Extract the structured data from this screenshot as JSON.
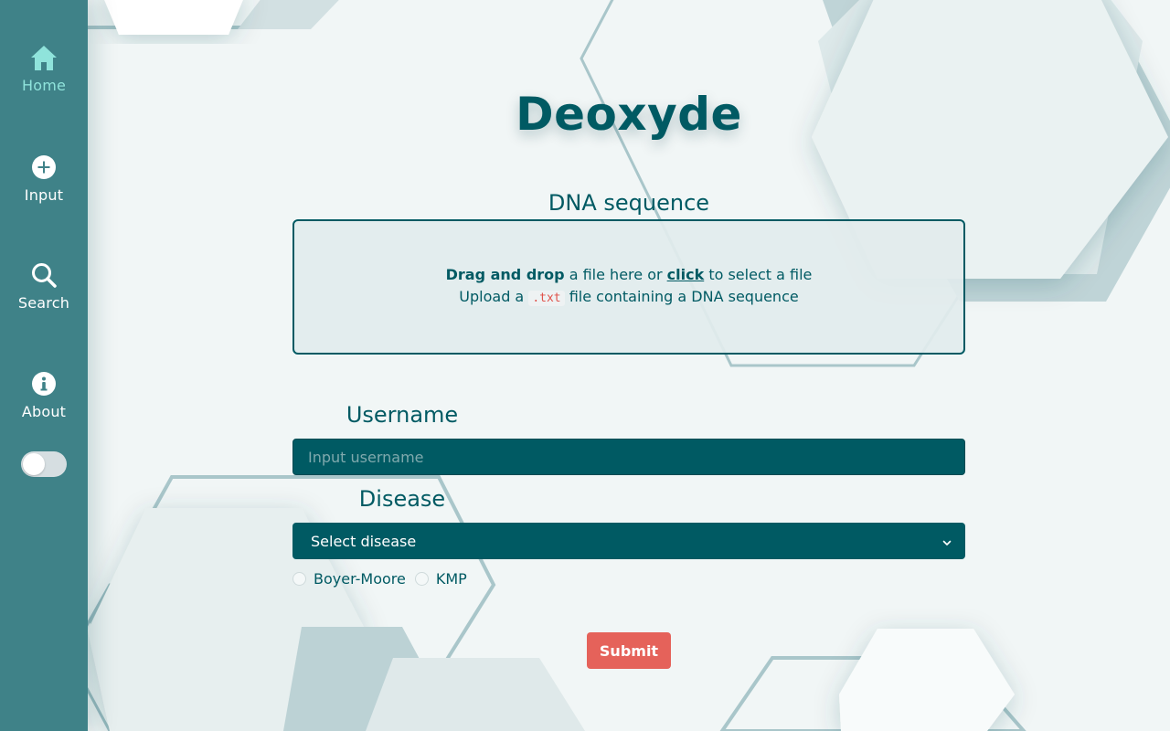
{
  "sidebar": {
    "items": [
      {
        "label": "Home",
        "icon": "home-icon",
        "active": true
      },
      {
        "label": "Input",
        "icon": "plus-circle-icon"
      },
      {
        "label": "Search",
        "icon": "search-icon"
      },
      {
        "label": "About",
        "icon": "info-icon"
      }
    ],
    "theme_toggle": {
      "on": false
    }
  },
  "main": {
    "title": "Deoxyde",
    "dna_section": {
      "label": "DNA sequence",
      "drop_bold": "Drag and drop",
      "drop_mid": " a file here or ",
      "drop_link": "click",
      "drop_end": " to select a file",
      "upload_prefix": "Upload a ",
      "file_ext": ".txt",
      "upload_suffix": " file containing a DNA sequence"
    },
    "username": {
      "label": "Username",
      "placeholder": "Input username",
      "value": ""
    },
    "disease": {
      "label": "Disease",
      "selected": "Select disease"
    },
    "algorithms": [
      {
        "label": "Boyer-Moore",
        "checked": false
      },
      {
        "label": "KMP",
        "checked": false
      }
    ],
    "submit_label": "Submit"
  },
  "colors": {
    "primary": "#005a63",
    "sidebar": "#3f8288",
    "active_nav": "#8fe3db",
    "submit": "#e5625a",
    "code_text": "#e0524a"
  }
}
